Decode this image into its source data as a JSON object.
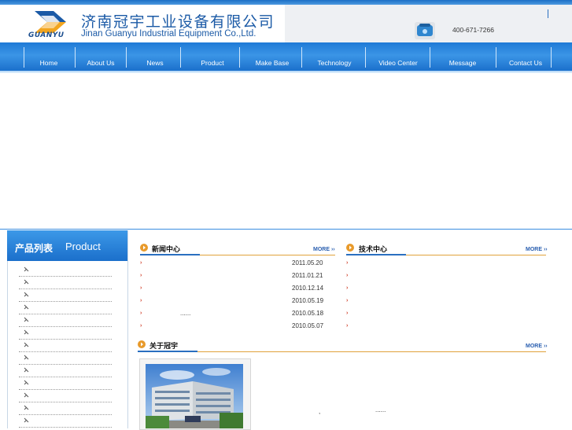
{
  "header": {
    "company_cn": "济南冠宇工业设备有限公司",
    "company_en": "Jinan Guanyu Industrial Equipment Co.,Ltd.",
    "logo_word": "GUANYU",
    "phone": "400-671-7266",
    "phone_icon": "phone-icon"
  },
  "nav": {
    "items": [
      "Home",
      "About Us",
      "News",
      "Product",
      "Make Base",
      "Technology",
      "Video Center",
      "Message",
      "Contact Us"
    ]
  },
  "products": {
    "title_cn": "产品列表",
    "title_en": "Product",
    "item_count": 13
  },
  "news": {
    "title": "新闻中心",
    "more": "MORE",
    "items": [
      {
        "text": "",
        "date": "2011.05.20"
      },
      {
        "text": "",
        "date": "2011.01.21"
      },
      {
        "text": "",
        "date": "2010.12.14"
      },
      {
        "text": "",
        "date": "2010.05.19"
      },
      {
        "text": "......",
        "date": "2010.05.18"
      },
      {
        "text": "",
        "date": "2010.05.07"
      }
    ]
  },
  "tech": {
    "title": "技术中心",
    "more": "MORE",
    "row_count": 6
  },
  "about": {
    "title": "关于冠宇",
    "more": "MORE",
    "text_a": ",",
    "text_b": "......"
  },
  "colors": {
    "nav_blue": "#1f7ad6",
    "brand_blue": "#1b5aa6",
    "accent_orange": "#e0a23b"
  }
}
